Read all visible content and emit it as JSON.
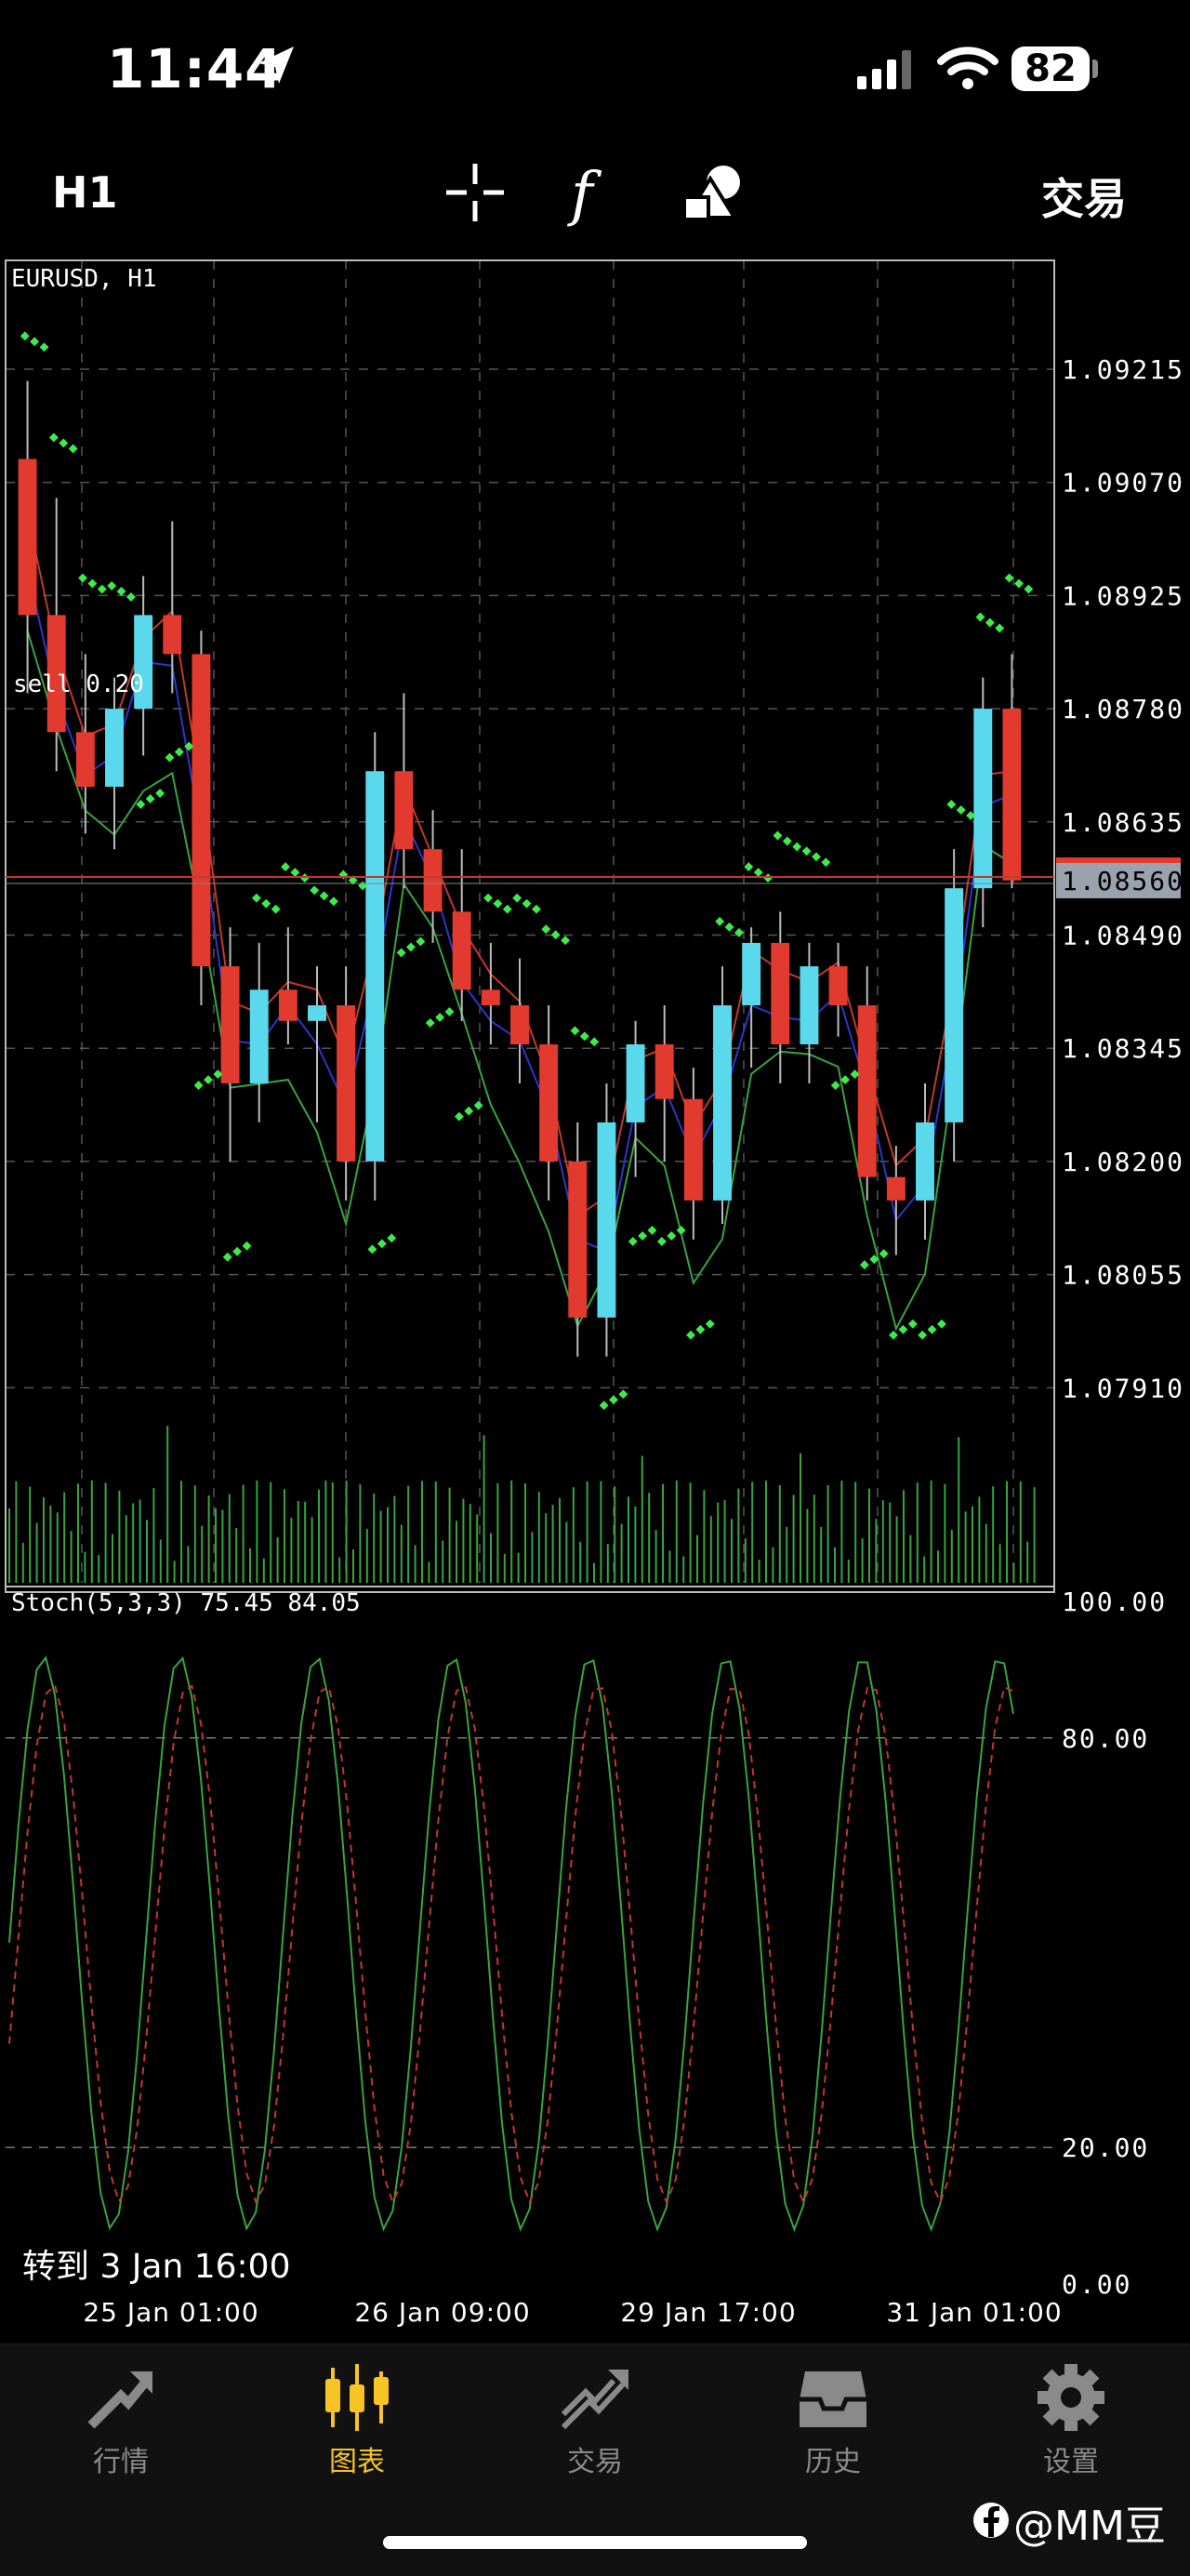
{
  "status": {
    "time": "11:44",
    "battery": "82"
  },
  "toolbar": {
    "timeframe": "H1",
    "function_label": "f",
    "trade": "交易"
  },
  "chart": {
    "symbol_label": "EURUSD, H1",
    "order_label": "sell 0.20",
    "current_price": "1.08560",
    "price_ticks": [
      "1.09215",
      "1.09070",
      "1.08925",
      "1.08780",
      "1.08635",
      "1.08490",
      "1.08345",
      "1.08200",
      "1.08055",
      "1.07910"
    ],
    "stoch_label": "Stoch(5,3,3) 75.45 84.05",
    "stoch_ticks": [
      "100.00",
      "80.00",
      "20.00",
      "0.00"
    ],
    "time_ticks": [
      "25 Jan 01:00",
      "26 Jan 09:00",
      "29 Jan 17:00",
      "31 Jan 01:00"
    ],
    "goto_label": "转到 3 Jan 16:00"
  },
  "chart_data": {
    "type": "candlestick",
    "title": "EURUSD, H1",
    "ylim": [
      1.0791,
      1.0936
    ],
    "candles": [
      {
        "o": 1.091,
        "h": 1.092,
        "l": 1.088,
        "c": 1.089
      },
      {
        "o": 1.089,
        "h": 1.0905,
        "l": 1.087,
        "c": 1.0875
      },
      {
        "o": 1.0875,
        "h": 1.0885,
        "l": 1.0862,
        "c": 1.0868
      },
      {
        "o": 1.0868,
        "h": 1.0882,
        "l": 1.086,
        "c": 1.0878
      },
      {
        "o": 1.0878,
        "h": 1.0895,
        "l": 1.0872,
        "c": 1.089
      },
      {
        "o": 1.089,
        "h": 1.0902,
        "l": 1.088,
        "c": 1.0885
      },
      {
        "o": 1.0885,
        "h": 1.0888,
        "l": 1.084,
        "c": 1.0845
      },
      {
        "o": 1.0845,
        "h": 1.085,
        "l": 1.082,
        "c": 1.083
      },
      {
        "o": 1.083,
        "h": 1.0848,
        "l": 1.0825,
        "c": 1.0842
      },
      {
        "o": 1.0842,
        "h": 1.085,
        "l": 1.0835,
        "c": 1.0838
      },
      {
        "o": 1.0838,
        "h": 1.0845,
        "l": 1.0825,
        "c": 1.084
      },
      {
        "o": 1.084,
        "h": 1.0845,
        "l": 1.0815,
        "c": 1.082
      },
      {
        "o": 1.082,
        "h": 1.0875,
        "l": 1.0815,
        "c": 1.087
      },
      {
        "o": 1.087,
        "h": 1.088,
        "l": 1.0855,
        "c": 1.086
      },
      {
        "o": 1.086,
        "h": 1.0865,
        "l": 1.0848,
        "c": 1.0852
      },
      {
        "o": 1.0852,
        "h": 1.086,
        "l": 1.0838,
        "c": 1.0842
      },
      {
        "o": 1.0842,
        "h": 1.0848,
        "l": 1.0835,
        "c": 1.084
      },
      {
        "o": 1.084,
        "h": 1.0846,
        "l": 1.083,
        "c": 1.0835
      },
      {
        "o": 1.0835,
        "h": 1.084,
        "l": 1.0815,
        "c": 1.082
      },
      {
        "o": 1.082,
        "h": 1.0825,
        "l": 1.0795,
        "c": 1.08
      },
      {
        "o": 1.08,
        "h": 1.083,
        "l": 1.0795,
        "c": 1.0825
      },
      {
        "o": 1.0825,
        "h": 1.0838,
        "l": 1.0818,
        "c": 1.0835
      },
      {
        "o": 1.0835,
        "h": 1.084,
        "l": 1.082,
        "c": 1.0828
      },
      {
        "o": 1.0828,
        "h": 1.0832,
        "l": 1.081,
        "c": 1.0815
      },
      {
        "o": 1.0815,
        "h": 1.0845,
        "l": 1.0812,
        "c": 1.084
      },
      {
        "o": 1.084,
        "h": 1.085,
        "l": 1.0832,
        "c": 1.0848
      },
      {
        "o": 1.0848,
        "h": 1.0852,
        "l": 1.083,
        "c": 1.0835
      },
      {
        "o": 1.0835,
        "h": 1.0848,
        "l": 1.083,
        "c": 1.0845
      },
      {
        "o": 1.0845,
        "h": 1.0848,
        "l": 1.0836,
        "c": 1.084
      },
      {
        "o": 1.084,
        "h": 1.0845,
        "l": 1.0815,
        "c": 1.0818
      },
      {
        "o": 1.0818,
        "h": 1.0822,
        "l": 1.0808,
        "c": 1.0815
      },
      {
        "o": 1.0815,
        "h": 1.083,
        "l": 1.081,
        "c": 1.0825
      },
      {
        "o": 1.0825,
        "h": 1.086,
        "l": 1.082,
        "c": 1.0855
      },
      {
        "o": 1.0855,
        "h": 1.0882,
        "l": 1.085,
        "c": 1.0878
      },
      {
        "o": 1.0878,
        "h": 1.0885,
        "l": 1.0855,
        "c": 1.0856
      }
    ],
    "stochastic": {
      "k": 75.45,
      "d": 84.05,
      "levels": [
        80,
        20
      ],
      "range": [
        0,
        100
      ]
    }
  },
  "nav": {
    "items": [
      {
        "label": "行情",
        "icon": "trend-arrow-icon",
        "active": false
      },
      {
        "label": "图表",
        "icon": "candlestick-icon",
        "active": true
      },
      {
        "label": "交易",
        "icon": "trade-chart-icon",
        "active": false
      },
      {
        "label": "历史",
        "icon": "inbox-icon",
        "active": false
      },
      {
        "label": "设置",
        "icon": "gear-icon",
        "active": false
      }
    ]
  },
  "watermark": "@MM豆",
  "colors": {
    "bull": "#5ad8ec",
    "bear": "#e23a2e",
    "accent": "#f7c325",
    "psar": "#3dec4a"
  }
}
